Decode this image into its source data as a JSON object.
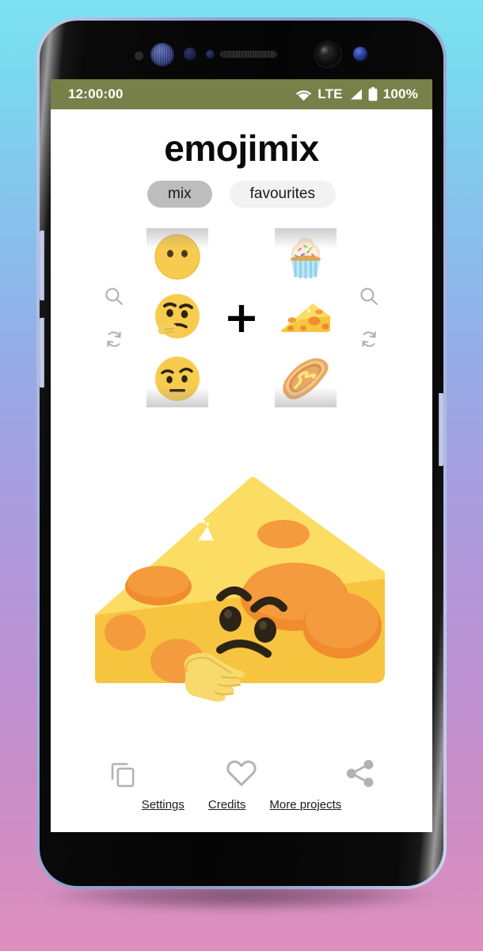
{
  "background": {
    "gradient_top": "#7de2f0",
    "gradient_bottom": "#de8fbe"
  },
  "device": {
    "frame_color": "#9aa8d2",
    "body_color": "#0a0a0a",
    "sensors": [
      "proximity-dot",
      "iris-scanner",
      "sensor-dot",
      "sensor-dot-small",
      "earpiece-speaker",
      "front-camera",
      "status-led"
    ],
    "buttons": [
      "volume-up",
      "volume-down",
      "power"
    ]
  },
  "statusbar": {
    "time": "12:00:00",
    "network": "LTE",
    "battery": "100%",
    "background": "#78804a",
    "foreground": "#ffffff",
    "icons": [
      "wifi-icon",
      "signal-icon",
      "battery-icon"
    ]
  },
  "app": {
    "title": "emojimix",
    "tabs": [
      {
        "label": "mix",
        "active": true,
        "bg": "#bdbdbd"
      },
      {
        "label": "favourites",
        "active": false,
        "bg": "#f2f2f2"
      }
    ],
    "operator": "+",
    "left_picker": {
      "name": "left-emoji-picker",
      "controls": [
        "search-icon",
        "shuffle-icon"
      ],
      "items": [
        {
          "name": "dotted-line-face",
          "selected": false
        },
        {
          "name": "thinking-face",
          "selected": true
        },
        {
          "name": "face-with-raised-eyebrow",
          "selected": false
        }
      ]
    },
    "right_picker": {
      "name": "right-emoji-picker",
      "controls": [
        "search-icon",
        "shuffle-icon"
      ],
      "items": [
        {
          "name": "cupcake",
          "selected": false
        },
        {
          "name": "cheese-wedge",
          "selected": true
        },
        {
          "name": "hot-dog",
          "selected": false
        }
      ]
    },
    "result": {
      "name": "cheese-wedge-thinking-face",
      "description": "thinking face mixed with cheese wedge",
      "colors": {
        "cheese_light": "#fcdd63",
        "cheese_mid": "#f9d548",
        "cheese_body": "#f7c440",
        "cheese_shadow": "#f2b233",
        "holes": "#f08c2e",
        "holes_light": "#f49b3d",
        "face": "#2c2316",
        "hand": "#f7d96c"
      }
    },
    "actions": [
      {
        "name": "copy-button",
        "icon": "copy-icon"
      },
      {
        "name": "favourite-button",
        "icon": "heart-outline-icon"
      },
      {
        "name": "share-button",
        "icon": "share-icon"
      }
    ],
    "footer_links": [
      {
        "label": "Settings"
      },
      {
        "label": "Credits"
      },
      {
        "label": "More projects"
      }
    ],
    "icon_color": "#b3b3b3"
  }
}
